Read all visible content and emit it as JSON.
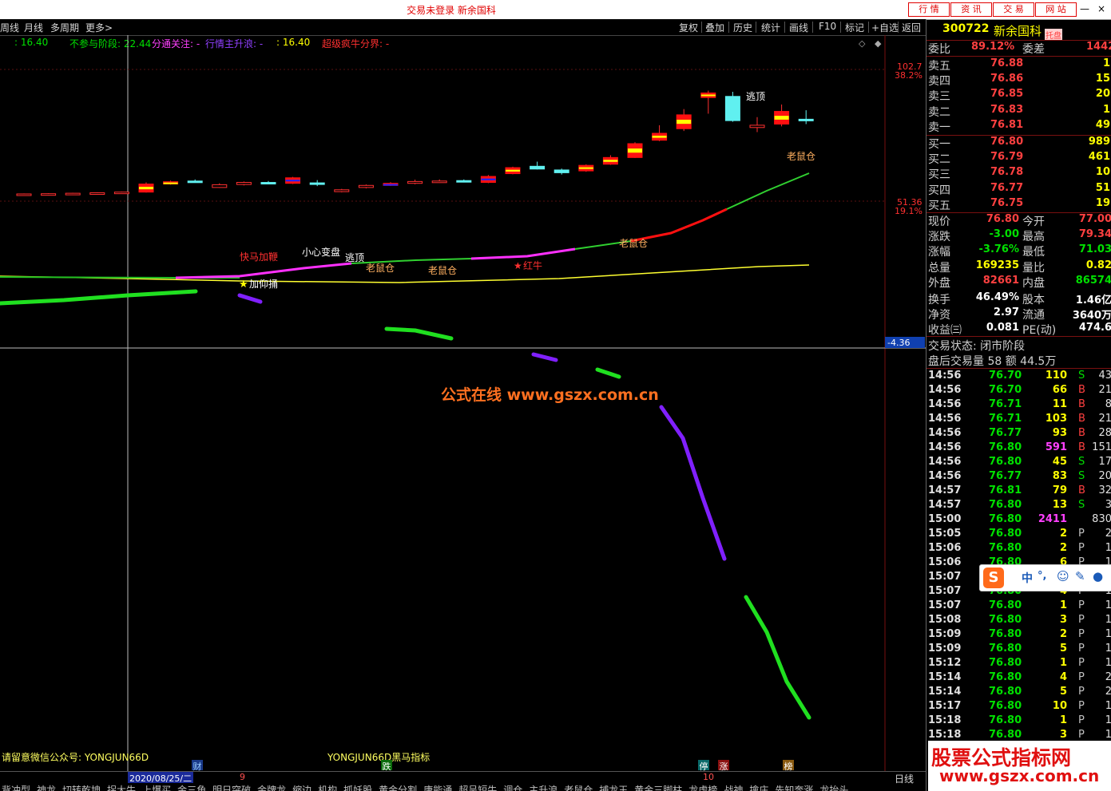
{
  "titlebar": {
    "title": "交易未登录  新余国科",
    "buttons": [
      "行 情",
      "资 讯",
      "交 易",
      "网 站"
    ],
    "win_controls": [
      "—",
      "□",
      "×"
    ]
  },
  "toolbar": {
    "left": [
      "周线",
      "月线",
      "多周期",
      "更多>"
    ],
    "right": [
      "复权",
      "叠加",
      "历史",
      "统计",
      "画线",
      "F10",
      "标记",
      "+自选",
      "返回"
    ]
  },
  "indicator_line": {
    "v1": ": 16.40",
    "v2": "不参与阶段: 22.44",
    "v3": "分通关注: -",
    "v4": "行情主升浪: -",
    "v5": ": 16.40",
    "v6": "超级疯牛分界: -"
  },
  "price_axis": {
    "p1": "102.7",
    "p1pct": "38.2%",
    "p2": "51.36",
    "p2pct": "19.1%",
    "p3": "-4.36"
  },
  "chart_texts": {
    "kuaima": "快马加鞭",
    "xiaoxin": "小心变盘",
    "taoding1": "逃顶",
    "laoshu1": "老鼠仓",
    "laoshu2": "老鼠仓",
    "hongniu": "红牛",
    "laoshu3": "老鼠仓",
    "taoding2": "逃顶",
    "laoshu4": "老鼠仓",
    "jiamijiang": "加仰捅",
    "watermark": "公式在线  www.gszx.com.cn",
    "star": "★"
  },
  "bottom": {
    "wechat": "请留意微信公众号: YONGJUN66D",
    "indicator_name": "YONGJUN66D黑马指标",
    "date": "2020/08/25/二",
    "mark9": "9",
    "mark10": "10",
    "cai": "财",
    "die": "跌",
    "ting": "停",
    "zhang": "涨",
    "bang": "榜",
    "period": "日线",
    "tabs": [
      "背冲型",
      "神龙",
      "切转乾坤",
      "拐大牛",
      "上爆买",
      "金三角",
      "明日突破",
      "金牌龙",
      "缩边",
      "机构",
      "抓妖股",
      "黄金分割",
      "唐能通",
      "超呈短牛",
      "调仓",
      "主升浪",
      "老鼠仓",
      "捕龙王",
      "黄金三脚柱",
      "龙虎榜",
      "战神",
      "擒庄",
      "先知奔涨",
      "龙抬头"
    ],
    "logo_cn": "股票公式指标网",
    "logo_url": "www.gszx.com.cn"
  },
  "quote": {
    "code": "300722",
    "name": "新余国科",
    "badge": "托盘",
    "weibi_label": "委比",
    "weibi": "89.12%",
    "weicha_label": "委差",
    "weicha": "1442",
    "asks": [
      {
        "label": "卖五",
        "price": "76.88",
        "vol": "1"
      },
      {
        "label": "卖四",
        "price": "76.86",
        "vol": "15"
      },
      {
        "label": "卖三",
        "price": "76.85",
        "vol": "20"
      },
      {
        "label": "卖二",
        "price": "76.83",
        "vol": "1"
      },
      {
        "label": "卖一",
        "price": "76.81",
        "vol": "49"
      }
    ],
    "bids": [
      {
        "label": "买一",
        "price": "76.80",
        "vol": "989"
      },
      {
        "label": "买二",
        "price": "76.79",
        "vol": "461"
      },
      {
        "label": "买三",
        "price": "76.78",
        "vol": "10"
      },
      {
        "label": "买四",
        "price": "76.77",
        "vol": "51"
      },
      {
        "label": "买五",
        "price": "76.75",
        "vol": "19"
      }
    ],
    "stats": [
      {
        "l1": "现价",
        "v1": "76.80",
        "c1": "#ff4040",
        "l2": "今开",
        "v2": "77.00",
        "c2": "#ff4040"
      },
      {
        "l1": "涨跌",
        "v1": "-3.00",
        "c1": "#00e000",
        "l2": "最高",
        "v2": "79.34",
        "c2": "#ff4040"
      },
      {
        "l1": "涨幅",
        "v1": "-3.76%",
        "c1": "#00e000",
        "l2": "最低",
        "v2": "71.03",
        "c2": "#00e000"
      },
      {
        "l1": "总量",
        "v1": "169235",
        "c1": "#ffff00",
        "l2": "量比",
        "v2": "0.82",
        "c2": "#ffff00"
      },
      {
        "l1": "外盘",
        "v1": "82661",
        "c1": "#ff4040",
        "l2": "内盘",
        "v2": "86574",
        "c2": "#00e000"
      },
      {
        "l1": "换手",
        "v1": "46.49%",
        "c1": "#ffffff",
        "l2": "股本",
        "v2": "1.46亿",
        "c2": "#ffffff"
      },
      {
        "l1": "净资",
        "v1": "2.97",
        "c1": "#ffffff",
        "l2": "流通",
        "v2": "3640万",
        "c2": "#ffffff"
      },
      {
        "l1": "收益㈢",
        "v1": "0.081",
        "c1": "#ffffff",
        "l2": "PE(动)",
        "v2": "474.6",
        "c2": "#ffffff"
      }
    ],
    "trade_status": "交易状态: 闭市阶段",
    "after_hours": "盘后交易量 58 额 44.5万",
    "ticks": [
      {
        "t": "14:56",
        "p": "76.70",
        "v": "110",
        "s": "S",
        "n": "43",
        "pc": "#00e000",
        "vc": "#ffff00",
        "sc": "#00e000"
      },
      {
        "t": "14:56",
        "p": "76.70",
        "v": "66",
        "s": "B",
        "n": "21",
        "pc": "#00e000",
        "vc": "#ffff00",
        "sc": "#ff4040"
      },
      {
        "t": "14:56",
        "p": "76.71",
        "v": "11",
        "s": "B",
        "n": "8",
        "pc": "#00e000",
        "vc": "#ffff00",
        "sc": "#ff4040"
      },
      {
        "t": "14:56",
        "p": "76.71",
        "v": "103",
        "s": "B",
        "n": "21",
        "pc": "#00e000",
        "vc": "#ffff00",
        "sc": "#ff4040"
      },
      {
        "t": "14:56",
        "p": "76.77",
        "v": "93",
        "s": "B",
        "n": "28",
        "pc": "#00e000",
        "vc": "#ffff00",
        "sc": "#ff4040"
      },
      {
        "t": "14:56",
        "p": "76.80",
        "v": "591",
        "s": "B",
        "n": "151",
        "pc": "#00e000",
        "vc": "#ff40ff",
        "sc": "#ff4040"
      },
      {
        "t": "14:56",
        "p": "76.80",
        "v": "45",
        "s": "S",
        "n": "17",
        "pc": "#00e000",
        "vc": "#ffff00",
        "sc": "#00e000"
      },
      {
        "t": "14:56",
        "p": "76.77",
        "v": "83",
        "s": "S",
        "n": "20",
        "pc": "#00e000",
        "vc": "#ffff00",
        "sc": "#00e000"
      },
      {
        "t": "14:57",
        "p": "76.81",
        "v": "79",
        "s": "B",
        "n": "32",
        "pc": "#00e000",
        "vc": "#ffff00",
        "sc": "#ff4040"
      },
      {
        "t": "14:57",
        "p": "76.80",
        "v": "13",
        "s": "S",
        "n": "3",
        "pc": "#00e000",
        "vc": "#ffff00",
        "sc": "#00e000"
      },
      {
        "t": "15:00",
        "p": "76.80",
        "v": "2411",
        "s": "",
        "n": "830",
        "pc": "#00e000",
        "vc": "#ff40ff",
        "sc": "#c0c0c0"
      },
      {
        "t": "15:05",
        "p": "76.80",
        "v": "2",
        "s": "P",
        "n": "2",
        "pc": "#00e000",
        "vc": "#ffff00",
        "sc": "#c0c0c0"
      },
      {
        "t": "15:06",
        "p": "76.80",
        "v": "2",
        "s": "P",
        "n": "1",
        "pc": "#00e000",
        "vc": "#ffff00",
        "sc": "#c0c0c0"
      },
      {
        "t": "15:06",
        "p": "76.80",
        "v": "6",
        "s": "P",
        "n": "1",
        "pc": "#00e000",
        "vc": "#ffff00",
        "sc": "#c0c0c0"
      },
      {
        "t": "15:07",
        "p": "76.80",
        "v": "1",
        "s": "P",
        "n": "1",
        "pc": "#00e000",
        "vc": "#ffff00",
        "sc": "#c0c0c0"
      },
      {
        "t": "15:07",
        "p": "76.80",
        "v": "4",
        "s": "P",
        "n": "1",
        "pc": "#00e000",
        "vc": "#ffff00",
        "sc": "#c0c0c0"
      },
      {
        "t": "15:07",
        "p": "76.80",
        "v": "1",
        "s": "P",
        "n": "1",
        "pc": "#00e000",
        "vc": "#ffff00",
        "sc": "#c0c0c0"
      },
      {
        "t": "15:08",
        "p": "76.80",
        "v": "3",
        "s": "P",
        "n": "1",
        "pc": "#00e000",
        "vc": "#ffff00",
        "sc": "#c0c0c0"
      },
      {
        "t": "15:09",
        "p": "76.80",
        "v": "2",
        "s": "P",
        "n": "1",
        "pc": "#00e000",
        "vc": "#ffff00",
        "sc": "#c0c0c0"
      },
      {
        "t": "15:09",
        "p": "76.80",
        "v": "5",
        "s": "P",
        "n": "1",
        "pc": "#00e000",
        "vc": "#ffff00",
        "sc": "#c0c0c0"
      },
      {
        "t": "15:12",
        "p": "76.80",
        "v": "1",
        "s": "P",
        "n": "1",
        "pc": "#00e000",
        "vc": "#ffff00",
        "sc": "#c0c0c0"
      },
      {
        "t": "15:14",
        "p": "76.80",
        "v": "4",
        "s": "P",
        "n": "2",
        "pc": "#00e000",
        "vc": "#ffff00",
        "sc": "#c0c0c0"
      },
      {
        "t": "15:14",
        "p": "76.80",
        "v": "5",
        "s": "P",
        "n": "2",
        "pc": "#00e000",
        "vc": "#ffff00",
        "sc": "#c0c0c0"
      },
      {
        "t": "15:17",
        "p": "76.80",
        "v": "10",
        "s": "P",
        "n": "1",
        "pc": "#00e000",
        "vc": "#ffff00",
        "sc": "#c0c0c0"
      },
      {
        "t": "15:18",
        "p": "76.80",
        "v": "1",
        "s": "P",
        "n": "1",
        "pc": "#00e000",
        "vc": "#ffff00",
        "sc": "#c0c0c0"
      },
      {
        "t": "15:18",
        "p": "76.80",
        "v": "3",
        "s": "P",
        "n": "1",
        "pc": "#00e000",
        "vc": "#ffff00",
        "sc": "#c0c0c0"
      }
    ],
    "ime": {
      "zhong": "中",
      "dot": "°,"
    }
  },
  "chart_data": {
    "type": "candlestick",
    "candles": [
      {
        "o": 71.8,
        "c": 72.2,
        "h": 72.4,
        "l": 71.6,
        "fill": "hollow-red"
      },
      {
        "o": 71.9,
        "c": 72.3,
        "h": 72.5,
        "l": 71.7,
        "fill": "hollow-red"
      },
      {
        "o": 72.0,
        "c": 72.5,
        "h": 72.7,
        "l": 71.8,
        "fill": "hollow-red"
      },
      {
        "o": 72.1,
        "c": 72.7,
        "h": 72.9,
        "l": 71.9,
        "fill": "hollow-red"
      },
      {
        "o": 72.4,
        "c": 73.0,
        "h": 73.2,
        "l": 72.2,
        "fill": "hollow-red"
      },
      {
        "o": 73.0,
        "c": 76.5,
        "h": 77.2,
        "l": 72.8,
        "fill": "red-yellow"
      },
      {
        "o": 76.5,
        "c": 77.5,
        "h": 78.0,
        "l": 76.2,
        "fill": "red-yellow"
      },
      {
        "o": 77.6,
        "c": 77.8,
        "h": 78.5,
        "l": 77.1,
        "fill": "cyan"
      },
      {
        "o": 75.0,
        "c": 76.2,
        "h": 76.8,
        "l": 74.8,
        "fill": "hollow-red"
      },
      {
        "o": 76.3,
        "c": 77.2,
        "h": 77.6,
        "l": 75.9,
        "fill": "hollow-red"
      },
      {
        "o": 77.2,
        "c": 77.0,
        "h": 77.8,
        "l": 76.4,
        "fill": "cyan"
      },
      {
        "o": 76.8,
        "c": 79.2,
        "h": 79.6,
        "l": 76.5,
        "fill": "red-blue"
      },
      {
        "o": 77.0,
        "c": 76.4,
        "h": 78.2,
        "l": 75.6,
        "fill": "cyan"
      },
      {
        "o": 73.2,
        "c": 74.0,
        "h": 74.4,
        "l": 72.9,
        "fill": "hollow-red"
      },
      {
        "o": 75.0,
        "c": 75.9,
        "h": 76.3,
        "l": 74.6,
        "fill": "hollow-red"
      },
      {
        "o": 75.9,
        "c": 76.8,
        "h": 77.3,
        "l": 75.7,
        "fill": "red-blue"
      },
      {
        "o": 76.8,
        "c": 77.6,
        "h": 78.4,
        "l": 76.4,
        "fill": "hollow-red"
      },
      {
        "o": 77.5,
        "c": 77.8,
        "h": 78.5,
        "l": 77.0,
        "fill": "hollow-red"
      },
      {
        "o": 77.8,
        "c": 78.0,
        "h": 78.5,
        "l": 77.2,
        "fill": "cyan"
      },
      {
        "o": 77.2,
        "c": 79.8,
        "h": 80.4,
        "l": 76.9,
        "fill": "red-blue"
      },
      {
        "o": 81.0,
        "c": 83.6,
        "h": 84.0,
        "l": 80.7,
        "fill": "red-yellow"
      },
      {
        "o": 84.2,
        "c": 83.0,
        "h": 86.2,
        "l": 82.8,
        "fill": "cyan"
      },
      {
        "o": 81.4,
        "c": 82.6,
        "h": 83.2,
        "l": 80.6,
        "fill": "cyan"
      },
      {
        "o": 82.2,
        "c": 84.6,
        "h": 85.0,
        "l": 81.8,
        "fill": "red-yellow"
      },
      {
        "o": 85.1,
        "c": 88.0,
        "h": 89.0,
        "l": 84.8,
        "fill": "red-yellow"
      },
      {
        "o": 88.0,
        "c": 94.0,
        "h": 94.6,
        "l": 87.8,
        "fill": "red-yellow"
      },
      {
        "o": 95.5,
        "c": 98.5,
        "h": 102.0,
        "l": 95.1,
        "fill": "red-yellow"
      },
      {
        "o": 100.5,
        "c": 106.5,
        "h": 109.0,
        "l": 99.5,
        "fill": "red-yellow"
      },
      {
        "o": 116.0,
        "c": 114.0,
        "h": 117.0,
        "l": 107.0,
        "fill": "red-yellow"
      },
      {
        "o": 114.5,
        "c": 104.0,
        "h": 116.5,
        "l": 103.5,
        "fill": "cyan"
      },
      {
        "o": 101.0,
        "c": 102.0,
        "h": 105.5,
        "l": 99.0,
        "fill": "hollow-red"
      },
      {
        "o": 102.5,
        "c": 108.0,
        "h": 111.0,
        "l": 101.5,
        "fill": "red-yellow"
      },
      {
        "o": 104.5,
        "c": 104.6,
        "h": 108.5,
        "l": 102.5,
        "fill": "cyan"
      }
    ],
    "ylim": [
      31,
      121
    ]
  }
}
